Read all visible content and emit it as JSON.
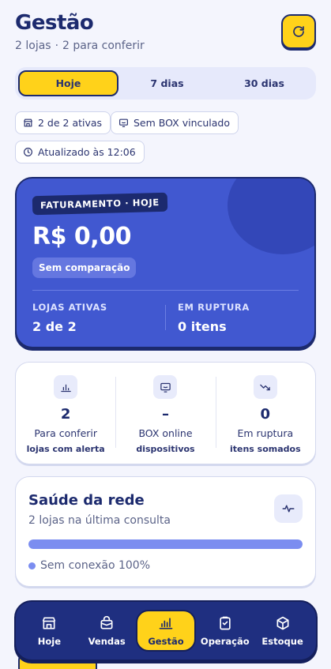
{
  "header": {
    "title": "Gestão",
    "subtitle_stores": "2 lojas",
    "subtitle_sep": "·",
    "subtitle_pending": "2 para conferir"
  },
  "period_tabs": [
    {
      "label": "Hoje",
      "active": true
    },
    {
      "label": "7 dias",
      "active": false
    },
    {
      "label": "30 dias",
      "active": false
    }
  ],
  "chips": {
    "active_stores": "2 de 2 ativas",
    "box": "Sem BOX vinculado",
    "updated": "Atualizado às 12:06"
  },
  "hero": {
    "tag": "FATURAMENTO · HOJE",
    "value": "R$ 0,00",
    "badge": "Sem comparação",
    "stores_label": "LOJAS ATIVAS",
    "stores_value": "2 de 2",
    "rupture_label": "EM RUPTURA",
    "rupture_value": "0 itens"
  },
  "stats": [
    {
      "icon": "bar-chart-icon",
      "value": "2",
      "label": "Para conferir",
      "sub": "lojas com alerta"
    },
    {
      "icon": "monitor-icon",
      "value": "–",
      "label": "BOX online",
      "sub": "dispositivos"
    },
    {
      "icon": "trend-down-icon",
      "value": "0",
      "label": "Em ruptura",
      "sub": "itens somados"
    }
  ],
  "health": {
    "title": "Saúde da rede",
    "subtitle": "2 lojas na última consulta",
    "progress": 1.0,
    "legend": "Sem conexão 100%"
  },
  "nav": [
    {
      "label": "Hoje",
      "icon": "store-icon",
      "active": false
    },
    {
      "label": "Vendas",
      "icon": "shopping-bag-icon",
      "active": false
    },
    {
      "label": "Gestão",
      "icon": "chart-icon",
      "active": true
    },
    {
      "label": "Operação",
      "icon": "clipboard-icon",
      "active": false
    },
    {
      "label": "Estoque",
      "icon": "box-icon",
      "active": false
    }
  ],
  "colors": {
    "brand_blue": "#4158d0",
    "navy": "#1c2a6e",
    "accent_yellow": "#ffd21a",
    "bar": "#7b8df0"
  }
}
